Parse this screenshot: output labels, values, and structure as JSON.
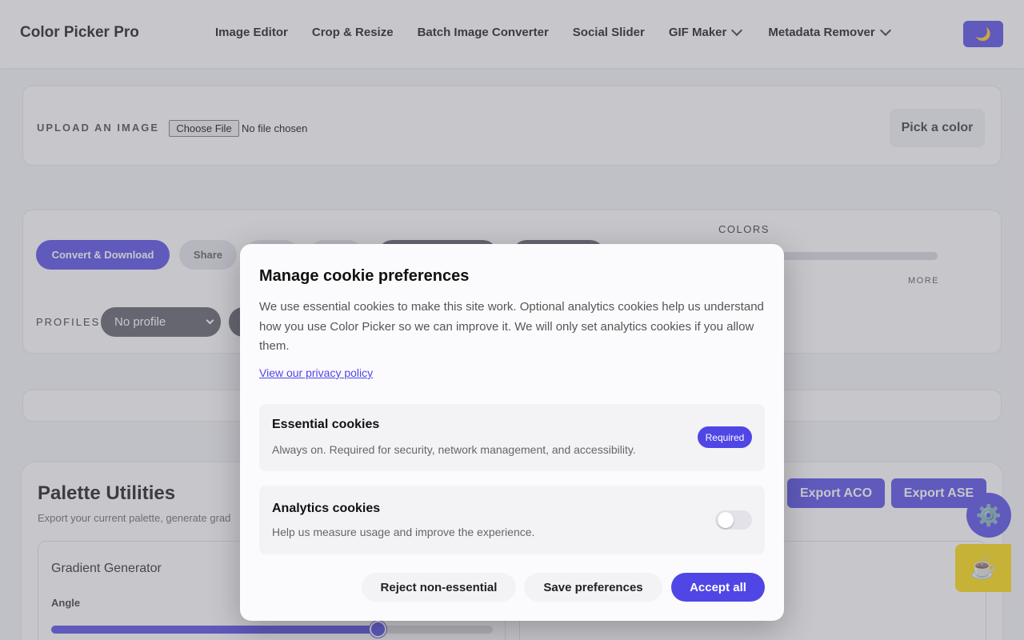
{
  "header": {
    "brand": "Color Picker Pro",
    "nav": [
      {
        "label": "Image Editor",
        "dropdown": false
      },
      {
        "label": "Crop & Resize",
        "dropdown": false
      },
      {
        "label": "Batch Image Converter",
        "dropdown": false
      },
      {
        "label": "Social Slider",
        "dropdown": false
      },
      {
        "label": "GIF Maker",
        "dropdown": true
      },
      {
        "label": "Metadata Remover",
        "dropdown": true
      }
    ],
    "theme_toggle_icon": "moon-icon",
    "theme_toggle_glyph": "🌙"
  },
  "upload": {
    "label": "UPLOAD AN IMAGE",
    "choose_file": "Choose File",
    "no_file": "No file chosen",
    "pick_color": "Pick a color"
  },
  "settings": {
    "convert_download": "Convert & Download",
    "share": "Share",
    "colors_label": "COLORS",
    "more_label": "MORE",
    "profiles_label": "PROFILES",
    "profile_selected": "No profile"
  },
  "palette": {
    "title": "Palette Utilities",
    "subtitle": "Export your current palette, generate grad",
    "export_aco": "Export ACO",
    "export_ase": "Export ASE",
    "gradient_title": "Gradient Generator",
    "angle_label": "Angle",
    "angle_fraction": 0.74
  },
  "fabs": {
    "gear_glyph": "⚙️",
    "coffee_glyph": "☕"
  },
  "cookie_modal": {
    "title": "Manage cookie preferences",
    "body": "We use essential cookies to make this site work. Optional analytics cookies help us understand how you use Color Picker so we can improve it. We will only set analytics cookies if you allow them.",
    "privacy_link": "View our privacy policy",
    "essential": {
      "title": "Essential cookies",
      "desc": "Always on. Required for security, network management, and accessibility.",
      "badge": "Required"
    },
    "analytics": {
      "title": "Analytics cookies",
      "desc": "Help us measure usage and improve the experience.",
      "enabled": false
    },
    "buttons": {
      "reject": "Reject non-essential",
      "save": "Save preferences",
      "accept": "Accept all"
    }
  },
  "colors": {
    "accent": "#4f46e5",
    "coffee": "#ffdd00"
  }
}
